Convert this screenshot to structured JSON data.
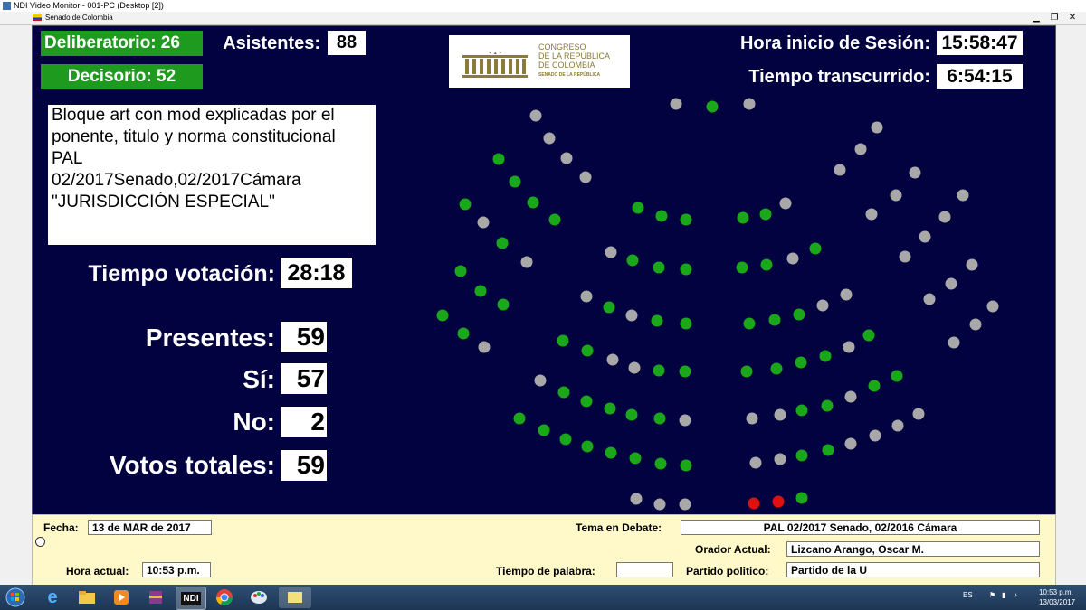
{
  "window": {
    "title": "NDI Video Monitor - 001-PC (Desktop [2])",
    "subtitle": "Senado de Colombia",
    "controls": {
      "minimize": "▁",
      "restore": "❐",
      "close": "✕"
    }
  },
  "header": {
    "deliberatorio": "Deliberatorio: 26",
    "decisorio": "Decisorio: 52",
    "asistentes_label": "Asistentes:",
    "asistentes_value": "88",
    "hora_inicio_label": "Hora inicio de Sesión:",
    "hora_inicio_value": "15:58:47",
    "tiempo_transcurrido_label": "Tiempo transcurrido:",
    "tiempo_transcurrido_value": "6:54:15"
  },
  "logo": {
    "line1": "CONGRESO",
    "line2": "DE LA REPÚBLICA",
    "line3": "DE COLOMBIA",
    "line4": "SENADO DE LA REPÚBLICA"
  },
  "bill_text": "Bloque art con mod explicadas por el\nponente, titulo y norma constitucional\nPAL\n02/2017Senado,02/2017Cámara\n\"JURISDICCIÓN ESPECIAL\"",
  "voting": {
    "tiempo_label": "Tiempo votación:",
    "tiempo_value": "28:18",
    "presentes_label": "Presentes:",
    "presentes_value": "59",
    "si_label": "Sí:",
    "si_value": "57",
    "no_label": "No:",
    "no_value": "2",
    "total_label": "Votos totales:",
    "total_value": "59"
  },
  "seat_colors": {
    "yes": "#1aa81a",
    "no": "#e01010",
    "absent": "#a8a8a8"
  },
  "bottom": {
    "fecha_label": "Fecha:",
    "fecha_value": "13 de MAR de 2017",
    "hora_label": "Hora actual:",
    "hora_value": "10:53 p.m.",
    "tema_label": "Tema en Debate:",
    "tema_value": "PAL 02/2017 Senado, 02/2016 Cámara",
    "orador_label": "Orador Actual:",
    "orador_value": "Lizcano Arango, Oscar M.",
    "tiempo_palabra_label": "Tiempo de palabra:",
    "tiempo_palabra_value": "",
    "partido_label": "Partido politico:",
    "partido_value": "Partido de la U"
  },
  "taskbar": {
    "language": "ES",
    "time": "10:53 p.m.",
    "date": "13/03/2017",
    "apps": [
      "start-orb-icon",
      "internet-explorer-icon",
      "file-explorer-icon",
      "media-player-icon",
      "winrar-icon",
      "ndi-icon",
      "chrome-icon",
      "paint-icon",
      "notes-icon"
    ],
    "ndi_label": "NDI"
  }
}
